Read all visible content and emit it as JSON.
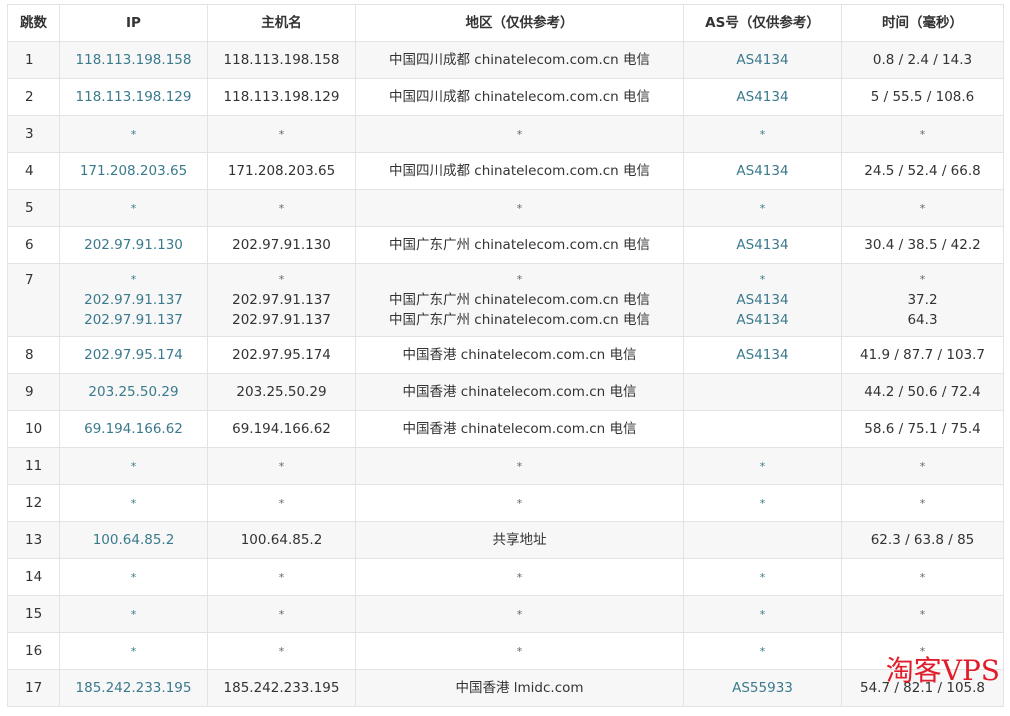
{
  "table": {
    "headers": [
      "跳数",
      "IP",
      "主机名",
      "地区（仅供参考）",
      "AS号（仅供参考）",
      "时间（毫秒）"
    ],
    "rows": [
      {
        "hop": "1",
        "entries": [
          {
            "ip": "118.113.198.158",
            "host": "118.113.198.158",
            "region": "中国四川成都 chinatelecom.com.cn 电信",
            "as": "AS4134",
            "time": "0.8 / 2.4 / 14.3"
          }
        ]
      },
      {
        "hop": "2",
        "entries": [
          {
            "ip": "118.113.198.129",
            "host": "118.113.198.129",
            "region": "中国四川成都 chinatelecom.com.cn 电信",
            "as": "AS4134",
            "time": "5 / 55.5 / 108.6"
          }
        ]
      },
      {
        "hop": "3",
        "entries": [
          {
            "ip": "*",
            "host": "*",
            "region": "*",
            "as": "*",
            "time": "*"
          }
        ]
      },
      {
        "hop": "4",
        "entries": [
          {
            "ip": "171.208.203.65",
            "host": "171.208.203.65",
            "region": "中国四川成都 chinatelecom.com.cn 电信",
            "as": "AS4134",
            "time": "24.5 / 52.4 / 66.8"
          }
        ]
      },
      {
        "hop": "5",
        "entries": [
          {
            "ip": "*",
            "host": "*",
            "region": "*",
            "as": "*",
            "time": "*"
          }
        ]
      },
      {
        "hop": "6",
        "entries": [
          {
            "ip": "202.97.91.130",
            "host": "202.97.91.130",
            "region": "中国广东广州 chinatelecom.com.cn 电信",
            "as": "AS4134",
            "time": "30.4 / 38.5 / 42.2"
          }
        ]
      },
      {
        "hop": "7",
        "entries": [
          {
            "ip": "*",
            "host": "*",
            "region": "*",
            "as": "*",
            "time": "*"
          },
          {
            "ip": "202.97.91.137",
            "host": "202.97.91.137",
            "region": "中国广东广州 chinatelecom.com.cn 电信",
            "as": "AS4134",
            "time": "37.2"
          },
          {
            "ip": "202.97.91.137",
            "host": "202.97.91.137",
            "region": "中国广东广州 chinatelecom.com.cn 电信",
            "as": "AS4134",
            "time": "64.3"
          }
        ]
      },
      {
        "hop": "8",
        "entries": [
          {
            "ip": "202.97.95.174",
            "host": "202.97.95.174",
            "region": "中国香港 chinatelecom.com.cn 电信",
            "as": "AS4134",
            "time": "41.9 / 87.7 / 103.7"
          }
        ]
      },
      {
        "hop": "9",
        "entries": [
          {
            "ip": "203.25.50.29",
            "host": "203.25.50.29",
            "region": "中国香港 chinatelecom.com.cn 电信",
            "as": "",
            "time": "44.2 / 50.6 / 72.4"
          }
        ]
      },
      {
        "hop": "10",
        "entries": [
          {
            "ip": "69.194.166.62",
            "host": "69.194.166.62",
            "region": "中国香港 chinatelecom.com.cn 电信",
            "as": "",
            "time": "58.6 / 75.1 / 75.4"
          }
        ]
      },
      {
        "hop": "11",
        "entries": [
          {
            "ip": "*",
            "host": "*",
            "region": "*",
            "as": "*",
            "time": "*"
          }
        ]
      },
      {
        "hop": "12",
        "entries": [
          {
            "ip": "*",
            "host": "*",
            "region": "*",
            "as": "*",
            "time": "*"
          }
        ]
      },
      {
        "hop": "13",
        "entries": [
          {
            "ip": "100.64.85.2",
            "host": "100.64.85.2",
            "region": "共享地址",
            "as": "",
            "time": "62.3 / 63.8 / 85"
          }
        ]
      },
      {
        "hop": "14",
        "entries": [
          {
            "ip": "*",
            "host": "*",
            "region": "*",
            "as": "*",
            "time": "*"
          }
        ]
      },
      {
        "hop": "15",
        "entries": [
          {
            "ip": "*",
            "host": "*",
            "region": "*",
            "as": "*",
            "time": "*"
          }
        ]
      },
      {
        "hop": "16",
        "entries": [
          {
            "ip": "*",
            "host": "*",
            "region": "*",
            "as": "*",
            "time": "*"
          }
        ]
      },
      {
        "hop": "17",
        "entries": [
          {
            "ip": "185.242.233.195",
            "host": "185.242.233.195",
            "region": "中国香港 lmidc.com",
            "as": "AS55933",
            "time": "54.7 / 82.1 / 105.8"
          }
        ]
      }
    ]
  },
  "watermark": "淘客VPS"
}
